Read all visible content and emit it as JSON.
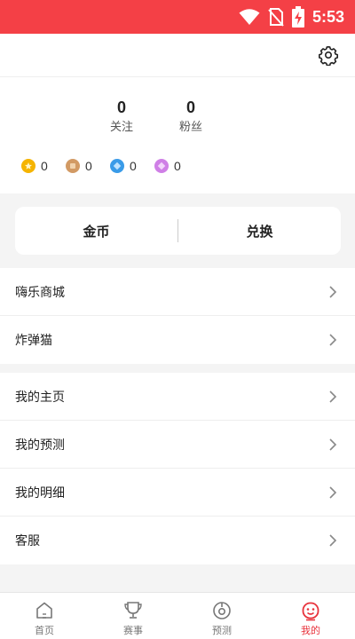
{
  "status_bar": {
    "time": "5:53",
    "color": "#f44046",
    "icons": [
      "wifi-icon",
      "no-sim-icon",
      "battery-charging-icon"
    ]
  },
  "header": {
    "settings_icon": "gear-icon"
  },
  "profile": {
    "stats": [
      {
        "value": "0",
        "label": "关注"
      },
      {
        "value": "0",
        "label": "粉丝"
      }
    ],
    "coins": [
      {
        "icon": "gold-coin-icon",
        "color": "#f5b400",
        "value": "0"
      },
      {
        "icon": "bronze-coin-icon",
        "color": "#d29a64",
        "value": "0"
      },
      {
        "icon": "blue-gem-icon",
        "color": "#3a9be8",
        "value": "0"
      },
      {
        "icon": "purple-gem-icon",
        "color": "#cf7fe6",
        "value": "0"
      }
    ]
  },
  "exchange_card": {
    "left_label": "金币",
    "right_label": "兑换"
  },
  "menu_group_1": [
    {
      "label": "嗨乐商城"
    },
    {
      "label": "炸弹猫"
    }
  ],
  "menu_group_2": [
    {
      "label": "我的主页"
    },
    {
      "label": "我的预测"
    },
    {
      "label": "我的明细"
    },
    {
      "label": "客服"
    }
  ],
  "tab_bar": {
    "active_color": "#e8323b",
    "tabs": [
      {
        "label": "首页",
        "icon": "home-icon",
        "active": false
      },
      {
        "label": "赛事",
        "icon": "trophy-icon",
        "active": false
      },
      {
        "label": "预测",
        "icon": "target-icon",
        "active": false
      },
      {
        "label": "我的",
        "icon": "smiley-icon",
        "active": true
      }
    ]
  }
}
